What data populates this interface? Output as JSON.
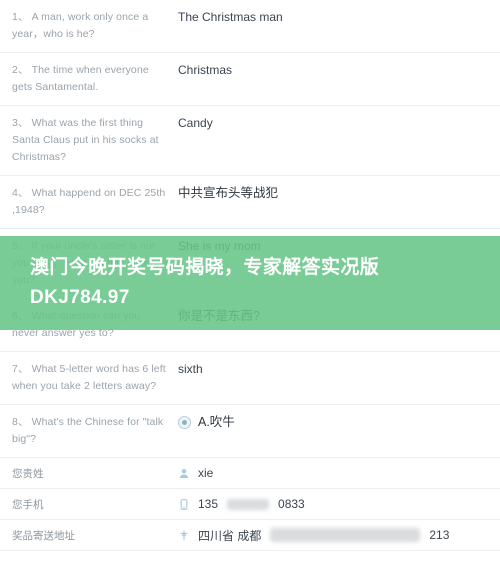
{
  "questions": [
    {
      "number": "1、",
      "question": "A man, work only once a year，who is he?",
      "answer": "The Christmas man",
      "answer_lang": "en",
      "has_radio": false
    },
    {
      "number": "2、",
      "question": "The time when everyone gets Santamental.",
      "answer": "Christmas",
      "answer_lang": "en",
      "has_radio": false
    },
    {
      "number": "3、",
      "question": "What was the first thing Santa Claus put in his socks at Christmas?",
      "answer": "Candy",
      "answer_lang": "en",
      "has_radio": false
    },
    {
      "number": "4、",
      "question": "What happend on DEC 25th ,1948?",
      "answer": "中共宣布头等战犯",
      "answer_lang": "cjk",
      "has_radio": false
    },
    {
      "number": "5、",
      "question": "If your uncle's sister is not you aunt，what relation is she to you?",
      "answer": "She is my mom",
      "answer_lang": "en",
      "has_radio": false
    },
    {
      "number": "6、",
      "question": "What question can you never answer yes to?",
      "answer": "你是不是东西?",
      "answer_lang": "cjk",
      "has_radio": false
    },
    {
      "number": "7、",
      "question": "What 5-letter word has 6 left when you take 2 letters away?",
      "answer": "sixth",
      "answer_lang": "en",
      "has_radio": false
    },
    {
      "number": "8、",
      "question": "What's the Chinese for \"talk big\"?",
      "answer": "A.吹牛",
      "answer_lang": "cjk",
      "has_radio": true
    }
  ],
  "info_rows": [
    {
      "label": "您贵姓",
      "icon": "user-icon",
      "value_before": "xie",
      "value_after": "",
      "redacted": "none"
    },
    {
      "label": "您手机",
      "icon": "phone-icon",
      "value_before": "135",
      "value_after": "0833",
      "redacted": "phone"
    },
    {
      "label": "奖品寄送地址",
      "icon": "location-pin-icon",
      "value_before": "四川省 成都",
      "value_after": "213",
      "redacted": "addr"
    }
  ],
  "overlay": {
    "text": "澳门今晚开奖号码揭晓，专家解答实况版DKJ784.97",
    "background_color": "#67c586",
    "text_color": "#ffffff"
  },
  "colors": {
    "question_text": "#9aa3ab",
    "answer_text": "#3c4450",
    "divider": "#eceff1",
    "icon": "#a8cbe0",
    "radio_fill": "#8fb3c4"
  }
}
